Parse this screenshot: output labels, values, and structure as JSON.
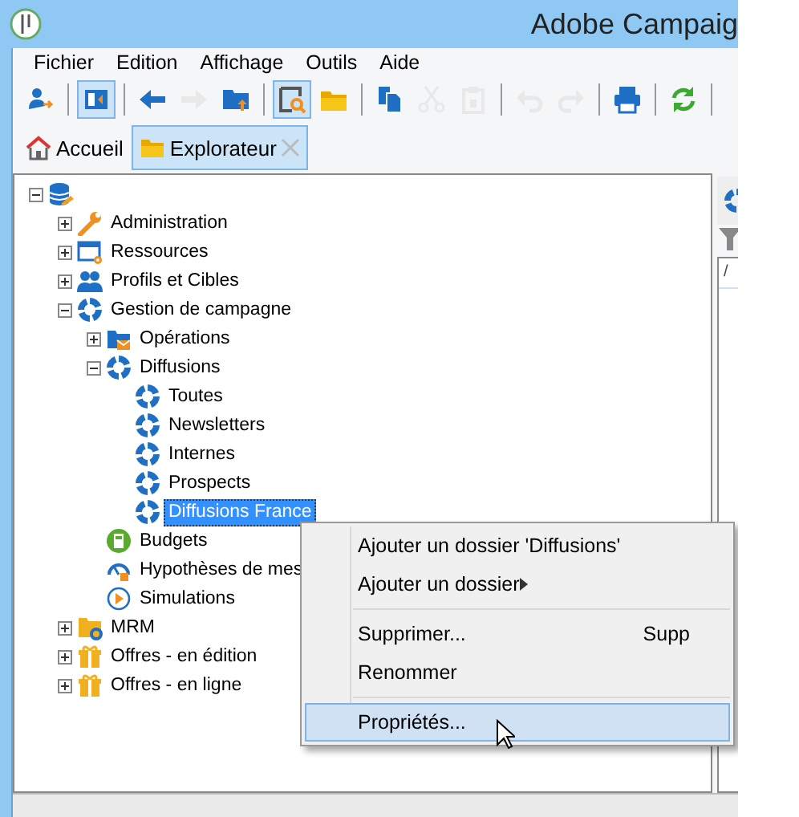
{
  "window": {
    "title": "Adobe Campaig"
  },
  "menu_bar": [
    "Fichier",
    "Edition",
    "Affichage",
    "Outils",
    "Aide"
  ],
  "toolbar": [
    {
      "kind": "user-add",
      "active": false,
      "disabled": false
    },
    {
      "kind": "separator"
    },
    {
      "kind": "panel",
      "active": true,
      "disabled": false
    },
    {
      "kind": "separator"
    },
    {
      "kind": "back",
      "active": false,
      "disabled": false
    },
    {
      "kind": "forward",
      "active": false,
      "disabled": true
    },
    {
      "kind": "folder-up",
      "active": false,
      "disabled": false
    },
    {
      "kind": "separator"
    },
    {
      "kind": "find",
      "active": true,
      "disabled": false
    },
    {
      "kind": "folder",
      "active": false,
      "disabled": false
    },
    {
      "kind": "separator"
    },
    {
      "kind": "copy",
      "active": false,
      "disabled": false
    },
    {
      "kind": "cut",
      "active": false,
      "disabled": true
    },
    {
      "kind": "paste",
      "active": false,
      "disabled": true
    },
    {
      "kind": "separator"
    },
    {
      "kind": "undo",
      "active": false,
      "disabled": true
    },
    {
      "kind": "redo",
      "active": false,
      "disabled": true
    },
    {
      "kind": "separator"
    },
    {
      "kind": "print",
      "active": false,
      "disabled": false
    },
    {
      "kind": "separator"
    },
    {
      "kind": "refresh",
      "active": false,
      "disabled": false
    },
    {
      "kind": "separator"
    }
  ],
  "tabs": [
    {
      "label": "Accueil",
      "kind": "home",
      "selected": false
    },
    {
      "label": "Explorateur",
      "kind": "folder",
      "selected": true
    }
  ],
  "tree": {
    "root": {
      "kind": "database",
      "expanded": true,
      "children": [
        {
          "label": "Administration",
          "kind": "wrench",
          "expanded": false,
          "selected": false
        },
        {
          "label": "Ressources",
          "kind": "window-gear",
          "expanded": false,
          "selected": false
        },
        {
          "label": "Profils et Cibles",
          "kind": "people",
          "expanded": false,
          "selected": false
        },
        {
          "label": "Gestion de campagne",
          "kind": "ring",
          "expanded": true,
          "selected": false,
          "children": [
            {
              "label": "Opérations",
              "kind": "folder-mail",
              "expanded": false,
              "selected": false
            },
            {
              "label": "Diffusions",
              "kind": "ring",
              "expanded": true,
              "selected": false,
              "children": [
                {
                  "label": "Toutes",
                  "kind": "ring",
                  "selected": false
                },
                {
                  "label": "Newsletters",
                  "kind": "ring",
                  "selected": false
                },
                {
                  "label": "Internes",
                  "kind": "ring",
                  "selected": false
                },
                {
                  "label": "Prospects",
                  "kind": "ring",
                  "selected": false
                },
                {
                  "label": "Diffusions France",
                  "kind": "ring",
                  "selected": true
                }
              ]
            },
            {
              "label": "Budgets",
              "kind": "calculator",
              "selected": false
            },
            {
              "label": "Hypothèses de mes",
              "kind": "gauge",
              "selected": false
            },
            {
              "label": "Simulations",
              "kind": "play",
              "selected": false
            }
          ]
        },
        {
          "label": "MRM",
          "kind": "folder-ring",
          "expanded": false,
          "selected": false
        },
        {
          "label": "Offres - en édition",
          "kind": "gift",
          "expanded": false,
          "selected": false
        },
        {
          "label": "Offres - en ligne",
          "kind": "gift",
          "expanded": false,
          "selected": false
        }
      ]
    }
  },
  "right_pane": {
    "column_1": "/"
  },
  "context_menu": [
    {
      "kind": "item",
      "label": "Ajouter un dossier 'Diffusions'",
      "submenu": false,
      "selected": false
    },
    {
      "kind": "item",
      "label": "Ajouter un dossier",
      "submenu": true,
      "selected": false
    },
    {
      "kind": "separator"
    },
    {
      "kind": "item",
      "label": "Supprimer...",
      "shortcut": "Supp",
      "submenu": false,
      "selected": false
    },
    {
      "kind": "item",
      "label": "Renommer",
      "submenu": false,
      "selected": false
    },
    {
      "kind": "separator"
    },
    {
      "kind": "item",
      "label": "Propriétés...",
      "submenu": false,
      "selected": true
    }
  ]
}
